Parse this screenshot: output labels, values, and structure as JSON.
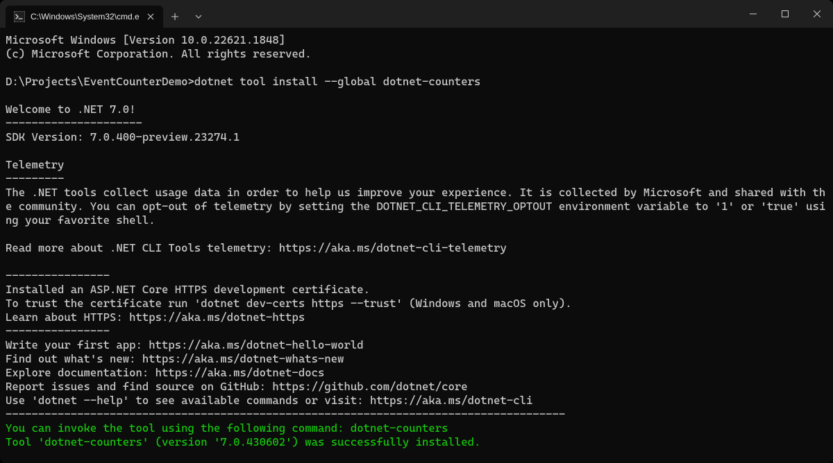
{
  "tab": {
    "title": "C:\\Windows\\System32\\cmd.e"
  },
  "term": {
    "l01": "Microsoft Windows [Version 10.0.22621.1848]",
    "l02": "(c) Microsoft Corporation. All rights reserved.",
    "l03": "",
    "l04a": "D:\\Projects\\EventCounterDemo>",
    "l04b": "dotnet tool install --global dotnet-counters",
    "l05": "",
    "l06": "Welcome to .NET 7.0!",
    "l07": "---------------------",
    "l08": "SDK Version: 7.0.400-preview.23274.1",
    "l09": "",
    "l10": "Telemetry",
    "l11": "---------",
    "l12": "The .NET tools collect usage data in order to help us improve your experience. It is collected by Microsoft and shared with the community. You can opt-out of telemetry by setting the DOTNET_CLI_TELEMETRY_OPTOUT environment variable to '1' or 'true' using your favorite shell.",
    "l13": "",
    "l14": "Read more about .NET CLI Tools telemetry: https://aka.ms/dotnet-cli-telemetry",
    "l15": "",
    "l16": "----------------",
    "l17": "Installed an ASP.NET Core HTTPS development certificate.",
    "l18": "To trust the certificate run 'dotnet dev-certs https --trust' (Windows and macOS only).",
    "l19": "Learn about HTTPS: https://aka.ms/dotnet-https",
    "l20": "----------------",
    "l21": "Write your first app: https://aka.ms/dotnet-hello-world",
    "l22": "Find out what's new: https://aka.ms/dotnet-whats-new",
    "l23": "Explore documentation: https://aka.ms/dotnet-docs",
    "l24": "Report issues and find source on GitHub: https://github.com/dotnet/core",
    "l25": "Use 'dotnet --help' to see available commands or visit: https://aka.ms/dotnet-cli",
    "l26": "--------------------------------------------------------------------------------------",
    "l27": "You can invoke the tool using the following command: dotnet-counters",
    "l28": "Tool 'dotnet-counters' (version '7.0.430602') was successfully installed."
  }
}
